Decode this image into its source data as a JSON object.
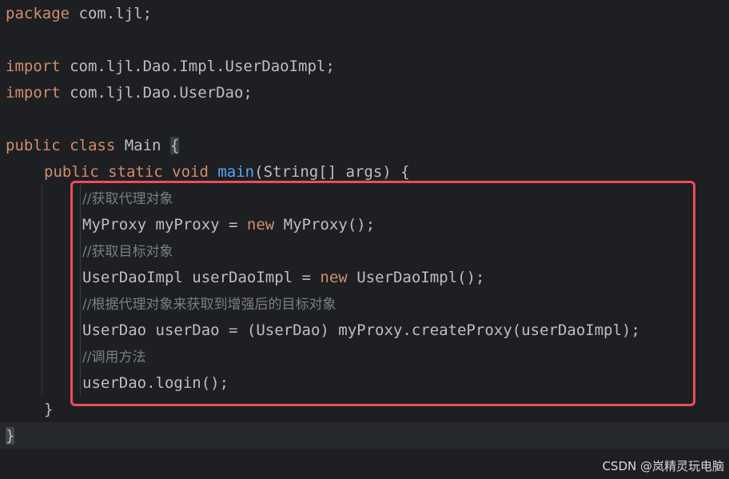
{
  "code": {
    "line1": {
      "kw": "package",
      "rest": " com.ljl;"
    },
    "line3": {
      "kw": "import",
      "rest": " com.ljl.Dao.Impl.UserDaoImpl;"
    },
    "line4": {
      "kw": "import",
      "rest": " com.ljl.Dao.UserDao;"
    },
    "line6": {
      "kw": "public class",
      "name": " Main ",
      "brace": "{"
    },
    "line7": {
      "kw": "public static void",
      "fn": "main",
      "rest": "(String[] args) {"
    },
    "line8": {
      "comment": "//获取代理对象"
    },
    "line9": {
      "pre": "MyProxy myProxy = ",
      "kw": "new",
      "post": " MyProxy();"
    },
    "line10": {
      "comment": "//获取目标对象"
    },
    "line11": {
      "pre": "UserDaoImpl userDaoImpl = ",
      "kw": "new",
      "post": " UserDaoImpl();"
    },
    "line12": {
      "comment": "//根据代理对象来获取到增强后的目标对象"
    },
    "line13": {
      "text": "UserDao userDao = (UserDao) myProxy.createProxy(userDaoImpl);"
    },
    "line14": {
      "comment": "//调用方法"
    },
    "line15": {
      "text": "userDao.login();"
    },
    "line16": {
      "text": "}"
    },
    "line17": {
      "text": "}"
    }
  },
  "watermark": "CSDN @岚精灵玩电脑",
  "colors": {
    "background": "#1e1f22",
    "keyword": "#cf8e6d",
    "function": "#56a8f5",
    "comment": "#7a7e85",
    "text": "#bcbec4",
    "highlight_box": "#f04b5a"
  }
}
